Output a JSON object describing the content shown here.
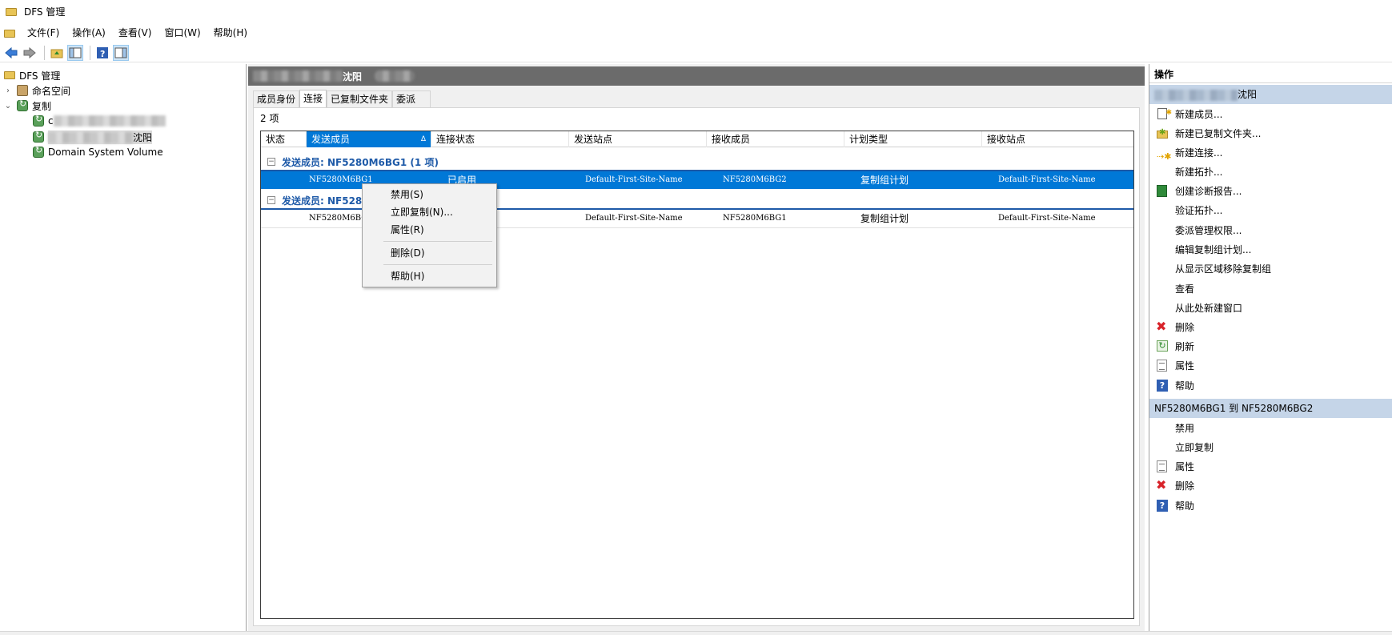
{
  "window": {
    "title": "DFS 管理"
  },
  "menu": [
    "文件(F)",
    "操作(A)",
    "查看(V)",
    "窗口(W)",
    "帮助(H)"
  ],
  "tree": {
    "root": "DFS 管理",
    "namespace": "命名空间",
    "replication": "复制",
    "group1_prefix": "c",
    "group2_suffix": "沈阳",
    "domain_system_volume": "Domain System Volume"
  },
  "middle": {
    "header_suffix": "沈阳",
    "tabs": [
      "成员身份",
      "连接",
      "已复制文件夹",
      "委派"
    ],
    "active_tab": "连接",
    "item_count": "2 项",
    "columns": [
      "状态",
      "发送成员",
      "连接状态",
      "发送站点",
      "接收成员",
      "计划类型",
      "接收站点"
    ],
    "sorted_column": "发送成员",
    "groups": [
      {
        "label": "发送成员: NF5280M6BG1 (1 项)",
        "row": {
          "sender": "NF5280M6BG1",
          "status": "已启用",
          "send_site": "Default-First-Site-Name",
          "receiver": "NF5280M6BG2",
          "schedule": "复制组计划",
          "recv_site": "Default-First-Site-Name"
        }
      },
      {
        "label": "发送成员: NF5280",
        "row": {
          "sender": "NF5280M6BG2",
          "status": "",
          "send_site": "Default-First-Site-Name",
          "receiver": "NF5280M6BG1",
          "schedule": "复制组计划",
          "recv_site": "Default-First-Site-Name"
        }
      }
    ]
  },
  "context_menu": [
    "禁用(S)",
    "立即复制(N)...",
    "属性(R)",
    "删除(D)",
    "帮助(H)"
  ],
  "actions": {
    "title": "操作",
    "section1": "沈阳",
    "section1_items": [
      "新建成员...",
      "新建已复制文件夹...",
      "新建连接...",
      "新建拓扑...",
      "创建诊断报告...",
      "验证拓扑...",
      "委派管理权限...",
      "编辑复制组计划...",
      "从显示区域移除复制组",
      "查看",
      "从此处新建窗口",
      "删除",
      "刷新",
      "属性",
      "帮助"
    ],
    "section2": "NF5280M6BG1 到 NF5280M6BG2",
    "section2_items": [
      "禁用",
      "立即复制",
      "属性",
      "删除",
      "帮助"
    ]
  },
  "colors": {
    "selection": "#0078d7",
    "group_text": "#1e5aa8",
    "section_bg": "#c5d5e8",
    "header_bg": "#6b6b6b",
    "delete_red": "#d8232a"
  }
}
